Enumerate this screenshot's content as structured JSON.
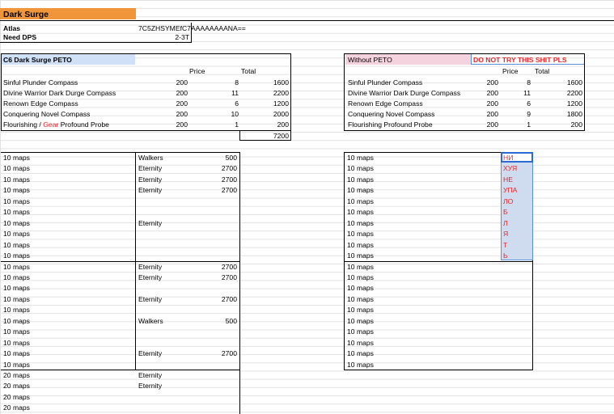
{
  "title": "Dark Surge",
  "atlas": {
    "label": "Atlas",
    "value": "7C5ZHSYMEfC7AAAAAAAANA=="
  },
  "dps": {
    "label": "Need DPS",
    "value": "2-3T"
  },
  "left_table": {
    "title": "C6 Dark Surge PETO",
    "headers": {
      "price": "Price",
      "total": "Total"
    },
    "rows": [
      {
        "name": "Sinful Plunder Compass",
        "price": "200",
        "qty": "8",
        "total": "1600"
      },
      {
        "name": "Divine Warrior Dark Durge Compass",
        "price": "200",
        "qty": "11",
        "total": "2200"
      },
      {
        "name": "Renown Edge Compass",
        "price": "200",
        "qty": "6",
        "total": "1200"
      },
      {
        "name": "Conquering Novel Compass",
        "price": "200",
        "qty": "10",
        "total": "2000"
      },
      {
        "name_pre": "Flourishing / ",
        "name_red": "Gear",
        "name_post": " Profound Probe",
        "price": "200",
        "qty": "1",
        "total": "200"
      }
    ],
    "sum": "7200"
  },
  "right_table": {
    "title": "Without PETO",
    "warning": "DO NOT TRY THIS SHIT PLS",
    "headers": {
      "price": "Price",
      "total": "Total"
    },
    "rows": [
      {
        "name": "Sinful Plunder Compass",
        "price": "200",
        "qty": "8",
        "total": "1600"
      },
      {
        "name": "Divine Warrior Dark Durge Compass",
        "price": "200",
        "qty": "11",
        "total": "2200"
      },
      {
        "name": "Renown Edge Compass",
        "price": "200",
        "qty": "6",
        "total": "1200"
      },
      {
        "name": "Conquering Novel Compass",
        "price": "200",
        "qty": "9",
        "total": "1800"
      },
      {
        "name": "Flourishing Profound Probe",
        "price": "200",
        "qty": "1",
        "total": "200"
      }
    ]
  },
  "left_maps": [
    {
      "maps": "10 maps",
      "type": "Walkers",
      "value": "500"
    },
    {
      "maps": "10 maps",
      "type": "Eternity",
      "value": "2700"
    },
    {
      "maps": "10 maps",
      "type": "Eternity",
      "value": "2700"
    },
    {
      "maps": "10 maps",
      "type": "Eternity",
      "value": "2700"
    },
    {
      "maps": "10 maps",
      "type": "",
      "value": ""
    },
    {
      "maps": "10 maps",
      "type": "",
      "value": ""
    },
    {
      "maps": "10 maps",
      "type": "Eternity",
      "value": ""
    },
    {
      "maps": "10 maps",
      "type": "",
      "value": ""
    },
    {
      "maps": "10 maps",
      "type": "",
      "value": ""
    },
    {
      "maps": "10 maps",
      "type": "",
      "value": ""
    },
    {
      "maps": "10 maps",
      "type": "Eternity",
      "value": "2700"
    },
    {
      "maps": "10 maps",
      "type": "Eternity",
      "value": "2700"
    },
    {
      "maps": "10 maps",
      "type": "",
      "value": ""
    },
    {
      "maps": "10 maps",
      "type": "Eternity",
      "value": "2700"
    },
    {
      "maps": "10 maps",
      "type": "",
      "value": ""
    },
    {
      "maps": "10 maps",
      "type": "Walkers",
      "value": "500"
    },
    {
      "maps": "10 maps",
      "type": "",
      "value": ""
    },
    {
      "maps": "10 maps",
      "type": "",
      "value": ""
    },
    {
      "maps": "10 maps",
      "type": "Eternity",
      "value": "2700"
    },
    {
      "maps": "10 maps",
      "type": "",
      "value": ""
    },
    {
      "maps": "20 maps",
      "type": "Eternity",
      "value": ""
    },
    {
      "maps": "20 maps",
      "type": "Eternity",
      "value": ""
    },
    {
      "maps": "20 maps",
      "type": "",
      "value": ""
    },
    {
      "maps": "20 maps",
      "type": "",
      "value": ""
    }
  ],
  "right_maps": [
    "10 maps",
    "10 maps",
    "10 maps",
    "10 maps",
    "10 maps",
    "10 maps",
    "10 maps",
    "10 maps",
    "10 maps",
    "10 maps",
    "10 maps",
    "10 maps",
    "10 maps",
    "10 maps",
    "10 maps",
    "10 maps",
    "10 maps",
    "10 maps",
    "10 maps",
    "10 maps"
  ],
  "cyrillic": [
    "НИ",
    "ХУЯ",
    "НЕ",
    "УПА",
    "ЛО",
    "Б",
    "Л",
    "Я",
    "Т",
    "Ь"
  ],
  "colors": {
    "title_bg": "#f0953a",
    "left_header_bg": "#cfe0f7",
    "right_header_bg": "#f4d2de",
    "selection_bg": "#cfdcef",
    "red": "#e8262a"
  }
}
